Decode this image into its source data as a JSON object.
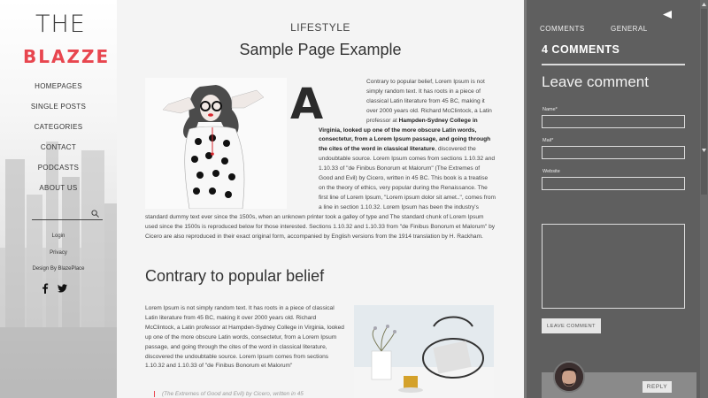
{
  "logo": {
    "line1": "THE",
    "line2": "BLAZZE"
  },
  "nav": [
    "HOMEPAGES",
    "SINGLE POSTS",
    "CATEGORIES",
    "CONTACT",
    "PODCASTS",
    "ABOUT US"
  ],
  "sidebar_links": {
    "login": "Login",
    "privacy": "Privacy",
    "credit": "Design By BlazePlace"
  },
  "social": {
    "facebook": "f"
  },
  "post": {
    "category": "LIFESTYLE",
    "title": "Sample Page Example",
    "dropcap": "A",
    "p1_a": "Contrary to popular belief, Lorem Ipsum is not simply random text. It has roots in a piece of classical Latin literature from 45 BC, making it over 2000 years old. Richard McClintock, a Latin professor at ",
    "p1_bold": "Hampden-Sydney College in Virginia, looked up one of the more obscure Latin words, consectetur, from a Lorem Ipsum passage, and going through the cites of the word in classical literature",
    "p1_b": ", discovered the undoubtable source. Lorem Ipsum comes from sections 1.10.32 and 1.10.33 of \"de Finibus Bonorum et Malorum\" (The Extremes of Good and Evil) by Cicero, written in 45 BC. This book is a treatise on the theory of ethics, very popular during the Renaissance. The first line of Lorem Ipsum, \"Lorem ipsum dolor sit amet..\", comes from a line in section 1.10.32. Lorem Ipsum has been the industry's standard dummy text ever since the 1500s, when an unknown printer took a galley of type and The standard chunk of Lorem Ipsum used since the 1500s is reproduced below for those interested. Sections 1.10.32 and 1.10.33 from \"de Finibus Bonorum et Malorum\" by Cicero are also reproduced in their exact original form, accompanied by English versions from the 1914 translation by H. Rackham.",
    "section_title": "Contrary to popular belief",
    "p2": "Lorem Ipsum is not simply random text. It has roots in a piece of classical Latin literature from 45 BC, making it over 2000 years old. Richard McClintock, a Latin professor at Hampden-Sydney College in Virginia, looked up one of the more obscure Latin words, consectetur, from a Lorem Ipsum passage, and going through the cites of the word in classical literature, discovered the undoubtable source. Lorem Ipsum comes from sections 1.10.32 and 1.10.33 of \"de Finibus Bonorum et Malorum\"",
    "quote": "(The Extremes of Good and Evil) by Cicero, written in 45"
  },
  "comments_panel": {
    "tab_comments": "COMMENTS",
    "tab_general": "GENERAL",
    "count_label": "4 COMMENTS",
    "leave_title": "Leave comment",
    "name_label": "Name*",
    "mail_label": "Mail*",
    "website_label": "Website",
    "submit_label": "LEAVE COMMENT",
    "reply_label": "REPLY"
  },
  "colors": {
    "accent": "#e8464f",
    "panel": "#5f5f5f"
  }
}
